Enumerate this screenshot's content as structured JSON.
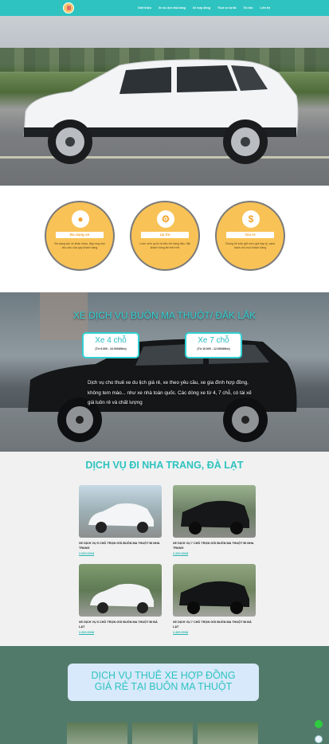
{
  "nav": {
    "items": [
      "Giới thiệu",
      "Xe du lịch nhà hàng",
      "Xe hợp đồng",
      "Thuê xe tự lái",
      "Tin tức",
      "Liên hệ"
    ]
  },
  "features": [
    {
      "icon": "car-icon",
      "title": "Đa dạng xe",
      "desc": "Đa dạng các xe khác nhau, đáp ứng mọi nhu cầu của quý khách hàng"
    },
    {
      "icon": "gear-icon",
      "title": "Uy tín",
      "desc": "Luôn xem uy tín là tiêu chí hàng đầu, đặt khách hàng lên trên hết"
    },
    {
      "icon": "dollar-icon",
      "title": "Giá rẻ",
      "desc": "Chúng tôi luôn giữ mức giá hợp lý, cạnh tranh cho mọi khách hàng"
    }
  ],
  "service": {
    "title": "XE DỊCH VỤ BUÔN MA THUỘT/ ĐẮK LẮK",
    "badges": [
      {
        "title": "Xe 4 chỗ",
        "sub": "(Từ 9.000 - 10.000đ/Km)"
      },
      {
        "title": "Xe 7 chỗ",
        "sub": "(Từ 10.000 - 12.000đ/Km)"
      }
    ],
    "desc": "Dịch vụ cho thuê xe du lịch giá rẻ, xe theo yêu cầu, xe gia đình hợp đồng, không tem mào... như xe nhà toàn quốc. Các dòng xe từ 4, 7 chỗ, có tài xế giá luôn rẻ và chất lượng"
  },
  "tours": {
    "title": "DỊCH VỤ ĐI NHA TRANG, ĐÀ LẠT",
    "cards": [
      {
        "name": "XE DỊCH VỤ 5 CHỖ TRỌN GÓI BUÔN MA THUỘT ĐI NHA TRANG",
        "price": "2.000.000đ"
      },
      {
        "name": "XE DỊCH VỤ 7 CHỖ TRỌN GÓI BUÔN MA THUỘT ĐI NHA TRANG",
        "price": "2.200.000đ"
      },
      {
        "name": "XE DỊCH VỤ 5 CHỖ TRỌN GÓI BUÔN MA THUỘT ĐI ĐÀ LẠT",
        "price": "2.200.000đ"
      },
      {
        "name": "XE DỊCH VỤ 7 CHỖ TRỌN GÓI BUÔN MA THUỘT ĐI ĐÀ LẠT",
        "price": "2.400.000đ"
      }
    ]
  },
  "contract": {
    "line1": "DỊCH VỤ THUÊ XE HỢP ĐỒNG",
    "line2": "GIÁ RẺ TẠI BUÔN MA THUỘT"
  },
  "colors": {
    "accent": "#2ec3c0",
    "feature_bg": "#f8c256",
    "contract_bg": "#527a6a"
  }
}
